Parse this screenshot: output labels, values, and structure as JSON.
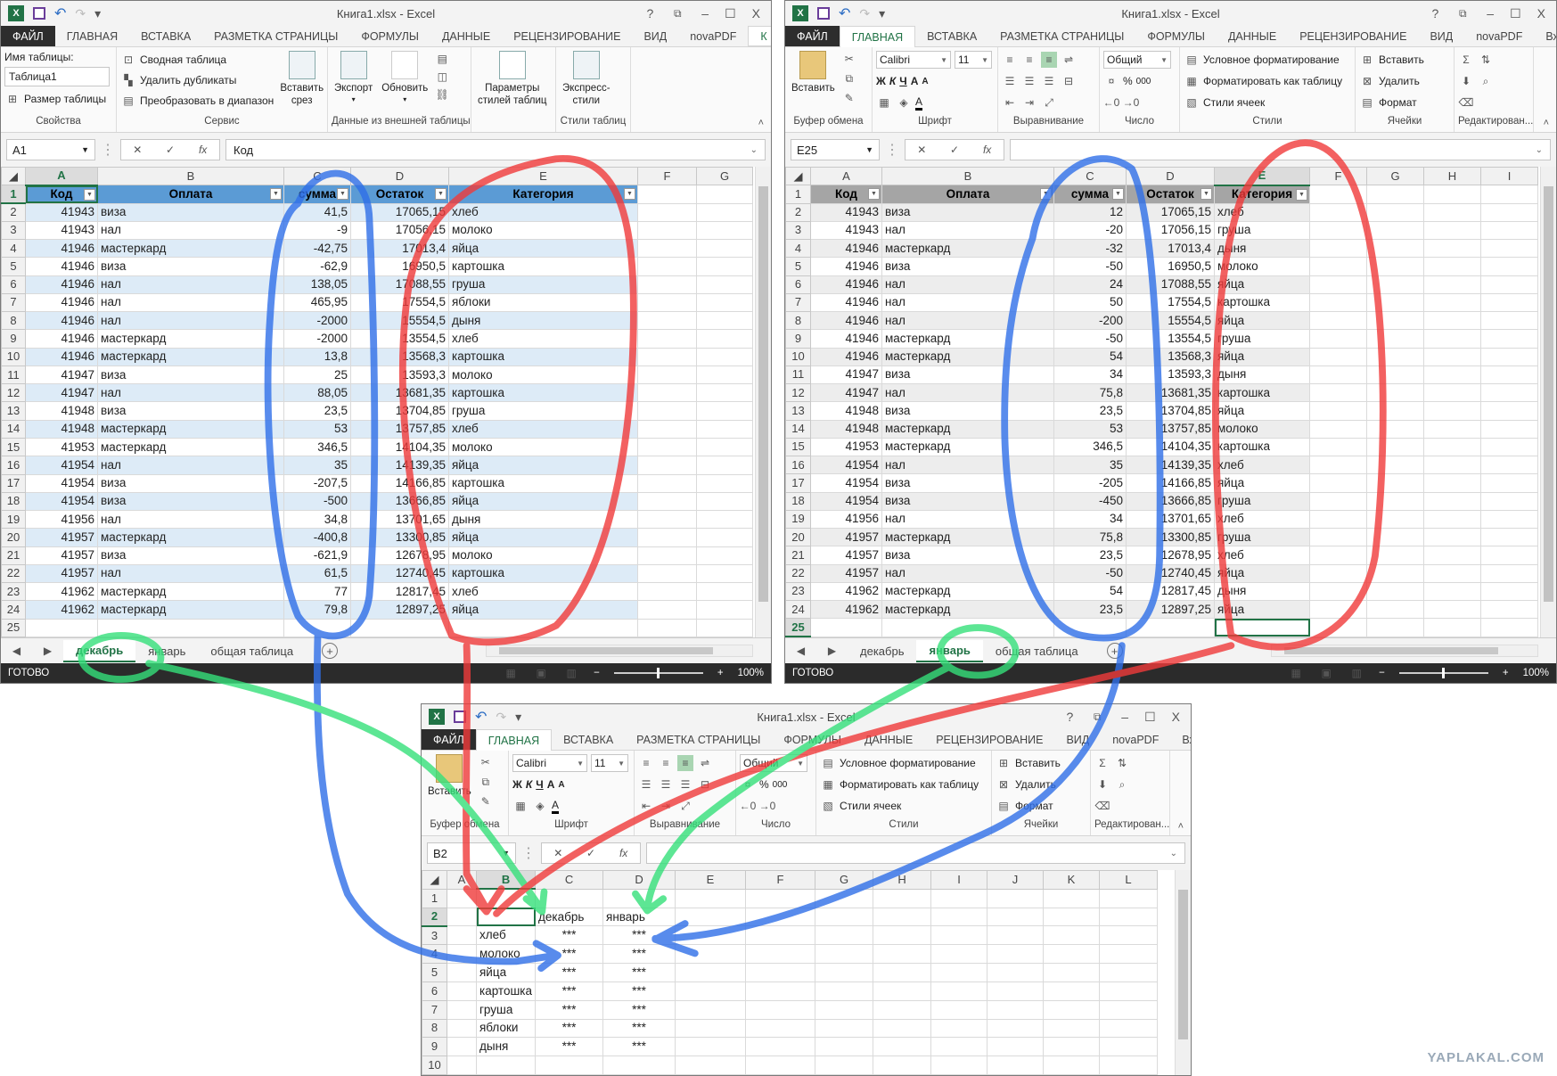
{
  "app": {
    "title": "Книга1.xlsx - Excel",
    "help": "?",
    "minimize": "–",
    "maximize": "☐",
    "close": "X"
  },
  "tabs": [
    "ФАЙЛ",
    "ГЛАВНАЯ",
    "ВСТАВКА",
    "РАЗМЕТКА СТРАНИЦЫ",
    "ФОРМУЛЫ",
    "ДАННЫЕ",
    "РЕЦЕНЗИРОВАНИЕ",
    "ВИД",
    "novaPDF"
  ],
  "ribbon_design": {
    "properties": {
      "label": "Свойства",
      "name_label": "Имя таблицы:",
      "name_value": "Таблица1",
      "resize": "Размер таблицы"
    },
    "tools": {
      "label": "Сервис",
      "pivot": "Сводная таблица",
      "remove_dup": "Удалить дубликаты",
      "convert": "Преобразовать в диапазон",
      "slicer_1": "Вставить",
      "slicer_2": "срез"
    },
    "external": {
      "label": "Данные из внешней таблицы",
      "export": "Экспорт",
      "refresh": "Обновить"
    },
    "style_options": {
      "line1": "Параметры",
      "line2": "стилей таблиц"
    },
    "styles": {
      "label": "Стили таблиц",
      "quick1": "Экспресс-",
      "quick2": "стили"
    }
  },
  "ribbon_home": {
    "clipboard": {
      "label": "Буфер обмена",
      "paste": "Вставить"
    },
    "font": {
      "label": "Шрифт",
      "name": "Calibri",
      "size": "11",
      "bold": "Ж",
      "italic": "К",
      "underline": "Ч",
      "grow": "A",
      "shrink": "A",
      "color": "A"
    },
    "alignment": {
      "label": "Выравнивание"
    },
    "number": {
      "label": "Число",
      "format": "Общий",
      "percent": "%",
      "thousands": "000"
    },
    "styles": {
      "label": "Стили",
      "conditional": "Условное форматирование",
      "as_table": "Форматировать как таблицу",
      "cell_styles": "Стили ячеек"
    },
    "cells": {
      "label": "Ячейки",
      "insert": "Вставить",
      "delete": "Удалить",
      "format": "Формат"
    },
    "editing": {
      "label": "Редактирован...",
      "sum": "Σ"
    }
  },
  "windows": [
    {
      "overflow_tab": "К",
      "name_box": "A1",
      "formula": "Код",
      "columns": [
        "A",
        "B",
        "C",
        "D",
        "E",
        "F",
        "G"
      ],
      "selected_col": "A",
      "selected_row": 1,
      "row_count": 25,
      "table_headers": [
        "Код",
        "Оплата",
        "сумма",
        "Остаток",
        "Категория"
      ],
      "rows": [
        [
          "41943",
          "виза",
          "41,5",
          "17065,15",
          "хлеб"
        ],
        [
          "41943",
          "нал",
          "-9",
          "17056,15",
          "молоко"
        ],
        [
          "41946",
          "мастеркард",
          "-42,75",
          "17013,4",
          "яйца"
        ],
        [
          "41946",
          "виза",
          "-62,9",
          "16950,5",
          "картошка"
        ],
        [
          "41946",
          "нал",
          "138,05",
          "17088,55",
          "груша"
        ],
        [
          "41946",
          "нал",
          "465,95",
          "17554,5",
          "яблоки"
        ],
        [
          "41946",
          "нал",
          "-2000",
          "15554,5",
          "дыня"
        ],
        [
          "41946",
          "мастеркард",
          "-2000",
          "13554,5",
          "хлеб"
        ],
        [
          "41946",
          "мастеркард",
          "13,8",
          "13568,3",
          "картошка"
        ],
        [
          "41947",
          "виза",
          "25",
          "13593,3",
          "молоко"
        ],
        [
          "41947",
          "нал",
          "88,05",
          "13681,35",
          "картошка"
        ],
        [
          "41948",
          "виза",
          "23,5",
          "13704,85",
          "груша"
        ],
        [
          "41948",
          "мастеркард",
          "53",
          "13757,85",
          "хлеб"
        ],
        [
          "41953",
          "мастеркард",
          "346,5",
          "14104,35",
          "молоко"
        ],
        [
          "41954",
          "нал",
          "35",
          "14139,35",
          "яйца"
        ],
        [
          "41954",
          "виза",
          "-207,5",
          "14166,85",
          "картошка"
        ],
        [
          "41954",
          "виза",
          "-500",
          "13666,85",
          "яйца"
        ],
        [
          "41956",
          "нал",
          "34,8",
          "13701,65",
          "дыня"
        ],
        [
          "41957",
          "мастеркард",
          "-400,8",
          "13300,85",
          "яйца"
        ],
        [
          "41957",
          "виза",
          "-621,9",
          "12678,95",
          "молоко"
        ],
        [
          "41957",
          "нал",
          "61,5",
          "12740,45",
          "картошка"
        ],
        [
          "41962",
          "мастеркард",
          "77",
          "12817,45",
          "хлеб"
        ],
        [
          "41962",
          "мастеркард",
          "79,8",
          "12897,25",
          "яйца"
        ]
      ],
      "sheet_tabs": [
        "декабрь",
        "январь",
        "общая таблица"
      ],
      "active_sheet": 0,
      "status": "ГОТОВО",
      "zoom": "100%"
    },
    {
      "overflow_tab": "Вхо,",
      "name_box": "E25",
      "formula": "",
      "columns": [
        "A",
        "B",
        "C",
        "D",
        "E",
        "F",
        "G",
        "H",
        "I"
      ],
      "selected_col": "E",
      "selected_row": 25,
      "row_count": 25,
      "table_headers": [
        "Код",
        "Оплата",
        "сумма",
        "Остаток",
        "Категория"
      ],
      "rows": [
        [
          "41943",
          "виза",
          "12",
          "17065,15",
          "хлеб"
        ],
        [
          "41943",
          "нал",
          "-20",
          "17056,15",
          "груша"
        ],
        [
          "41946",
          "мастеркард",
          "-32",
          "17013,4",
          "дыня"
        ],
        [
          "41946",
          "виза",
          "-50",
          "16950,5",
          "молоко"
        ],
        [
          "41946",
          "нал",
          "24",
          "17088,55",
          "яйца"
        ],
        [
          "41946",
          "нал",
          "50",
          "17554,5",
          "картошка"
        ],
        [
          "41946",
          "нал",
          "-200",
          "15554,5",
          "яйца"
        ],
        [
          "41946",
          "мастеркард",
          "-50",
          "13554,5",
          "груша"
        ],
        [
          "41946",
          "мастеркард",
          "54",
          "13568,3",
          "яйца"
        ],
        [
          "41947",
          "виза",
          "34",
          "13593,3",
          "дыня"
        ],
        [
          "41947",
          "нал",
          "75,8",
          "13681,35",
          "картошка"
        ],
        [
          "41948",
          "виза",
          "23,5",
          "13704,85",
          "яйца"
        ],
        [
          "41948",
          "мастеркард",
          "53",
          "13757,85",
          "молоко"
        ],
        [
          "41953",
          "мастеркард",
          "346,5",
          "14104,35",
          "картошка"
        ],
        [
          "41954",
          "нал",
          "35",
          "14139,35",
          "хлеб"
        ],
        [
          "41954",
          "виза",
          "-205",
          "14166,85",
          "яйца"
        ],
        [
          "41954",
          "виза",
          "-450",
          "13666,85",
          "груша"
        ],
        [
          "41956",
          "нал",
          "34",
          "13701,65",
          "хлеб"
        ],
        [
          "41957",
          "мастеркард",
          "75,8",
          "13300,85",
          "груша"
        ],
        [
          "41957",
          "виза",
          "23,5",
          "12678,95",
          "хлеб"
        ],
        [
          "41957",
          "нал",
          "-50",
          "12740,45",
          "яйца"
        ],
        [
          "41962",
          "мастеркард",
          "54",
          "12817,45",
          "дыня"
        ],
        [
          "41962",
          "мастеркард",
          "23,5",
          "12897,25",
          "яйца"
        ]
      ],
      "sheet_tabs": [
        "декабрь",
        "январь",
        "общая таблица"
      ],
      "active_sheet": 1,
      "status": "ГОТОВО",
      "zoom": "100%"
    },
    {
      "overflow_tab": "Вхо,",
      "name_box": "B2",
      "formula": "",
      "columns": [
        "A",
        "B",
        "C",
        "D",
        "E",
        "F",
        "G",
        "H",
        "I",
        "J",
        "K",
        "L"
      ],
      "selected_col": "B",
      "selected_row": 2,
      "row_count": 10,
      "cells": {
        "C2": "декабрь",
        "D2": "январь",
        "B3": "хлеб",
        "C3": "***",
        "D3": "***",
        "B4": "молоко",
        "C4": "***",
        "D4": "***",
        "B5": "яйца",
        "C5": "***",
        "D5": "***",
        "B6": "картошка",
        "C6": "***",
        "D6": "***",
        "B7": "груша",
        "C7": "***",
        "D7": "***",
        "B8": "яблоки",
        "C8": "***",
        "D8": "***",
        "B9": "дыня",
        "C9": "***",
        "D9": "***"
      }
    }
  ],
  "watermark": "YAPLAKAL.COM",
  "colors": {
    "excel_green": "#217346",
    "annotation_blue": "#2f6fe8",
    "annotation_red": "#f03a3a",
    "annotation_green": "#35e07a"
  }
}
